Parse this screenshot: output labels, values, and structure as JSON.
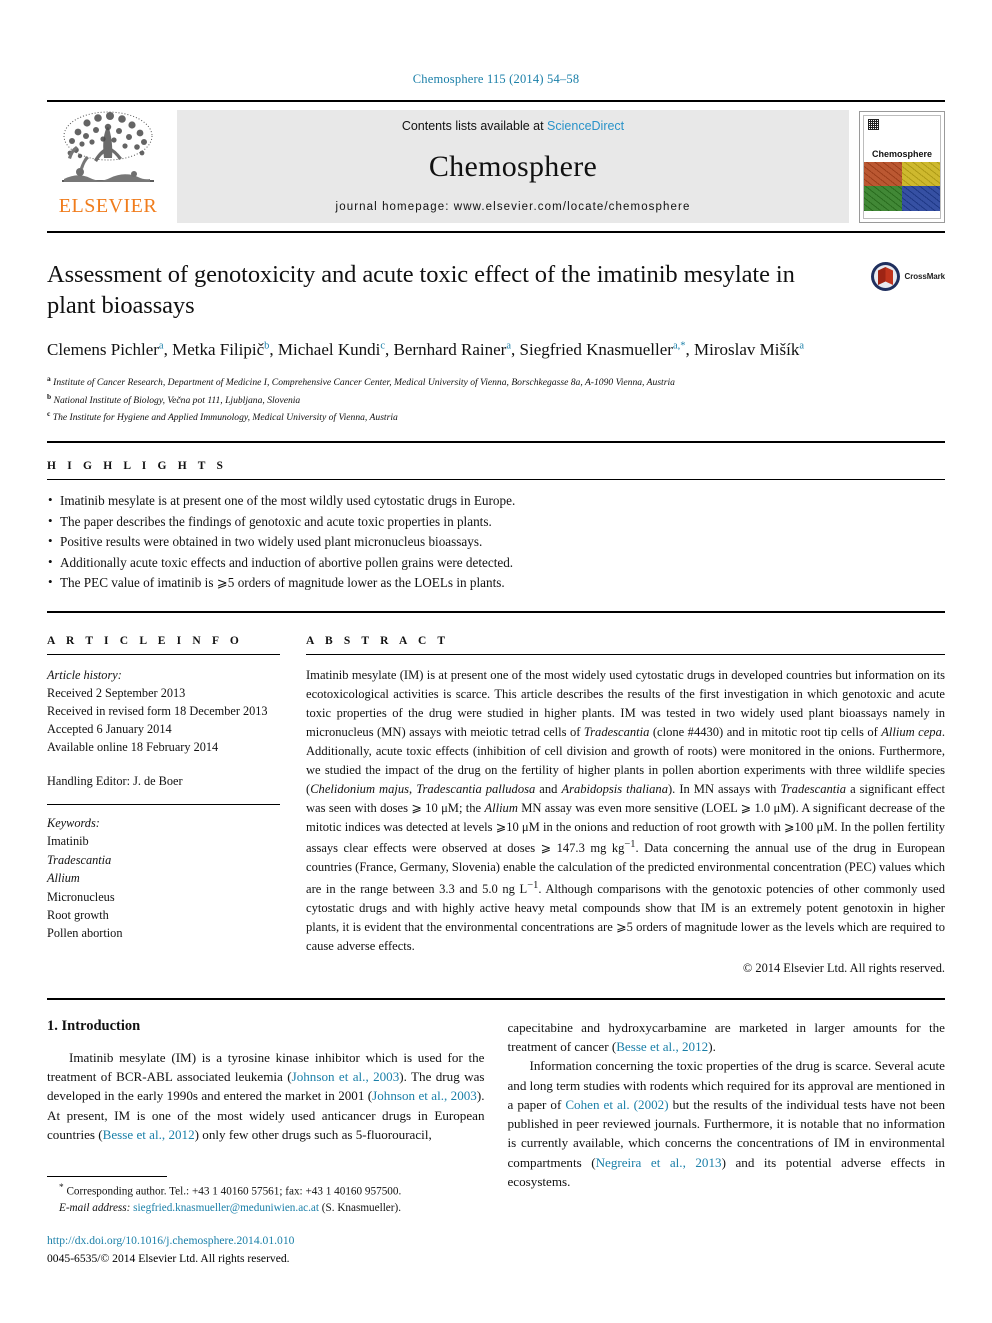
{
  "journal_ref": "Chemosphere 115 (2014) 54–58",
  "masthead": {
    "publisher": "ELSEVIER",
    "contents_prefix": "Contents lists available at ",
    "sciencedirect": "ScienceDirect",
    "journal_title": "Chemosphere",
    "homepage": "journal homepage: www.elsevier.com/locate/chemosphere",
    "cover_title": "Chemosphere",
    "cover_colors": [
      "#b5481f",
      "#c9b21a",
      "#2f7d23",
      "#23409a"
    ]
  },
  "article": {
    "title": "Assessment of genotoxicity and acute toxic effect of the imatinib mesylate in plant bioassays",
    "crossmark_label": "CrossMark",
    "authors": [
      {
        "name": "Clemens Pichler",
        "sup": "a"
      },
      {
        "name": "Metka Filipič",
        "sup": "b"
      },
      {
        "name": "Michael Kundi",
        "sup": "c"
      },
      {
        "name": "Bernhard Rainer",
        "sup": "a"
      },
      {
        "name": "Siegfried Knasmueller",
        "sup": "a,*"
      },
      {
        "name": "Miroslav Mišík",
        "sup": "a"
      }
    ],
    "affiliations": [
      {
        "label": "a",
        "text": "Institute of Cancer Research, Department of Medicine I, Comprehensive Cancer Center, Medical University of Vienna, Borschkegasse 8a, A-1090 Vienna, Austria"
      },
      {
        "label": "b",
        "text": "National Institute of Biology, Večna pot 111, Ljubljana, Slovenia"
      },
      {
        "label": "c",
        "text": "The Institute for Hygiene and Applied Immunology, Medical University of Vienna, Austria"
      }
    ]
  },
  "highlights": {
    "heading": "H I G H L I G H T S",
    "items": [
      "Imatinib mesylate is at present one of the most wildly used cytostatic drugs in Europe.",
      "The paper describes the findings of genotoxic and acute toxic properties in plants.",
      "Positive results were obtained in two widely used plant micronucleus bioassays.",
      "Additionally acute toxic effects and induction of abortive pollen grains were detected.",
      "The PEC value of imatinib is ⩾5 orders of magnitude lower as the LOELs in plants."
    ]
  },
  "article_info": {
    "heading": "A R T I C L E   I N F O",
    "history_label": "Article history:",
    "history": [
      "Received 2 September 2013",
      "Received in revised form 18 December 2013",
      "Accepted 6 January 2014",
      "Available online 18 February 2014"
    ],
    "handling_editor": "Handling Editor: J. de Boer",
    "keywords_label": "Keywords:",
    "keywords": [
      {
        "text": "Imatinib",
        "italic": false
      },
      {
        "text": "Tradescantia",
        "italic": true
      },
      {
        "text": "Allium",
        "italic": true
      },
      {
        "text": "Micronucleus",
        "italic": false
      },
      {
        "text": "Root growth",
        "italic": false
      },
      {
        "text": "Pollen abortion",
        "italic": false
      }
    ]
  },
  "abstract": {
    "heading": "A B S T R A C T",
    "html": "Imatinib mesylate (IM) is at present one of the most widely used cytostatic drugs in developed countries but information on its ecotoxicological activities is scarce. This article describes the results of the first investigation in which genotoxic and acute toxic properties of the drug were studied in higher plants. IM was tested in two widely used plant bioassays namely in micronucleus (MN) assays with meiotic tetrad cells of <i>Tradescantia</i> (clone #4430) and in mitotic root tip cells of <i>Allium cepa</i>. Additionally, acute toxic effects (inhibition of cell division and growth of roots) were monitored in the onions. Furthermore, we studied the impact of the drug on the fertility of higher plants in pollen abortion experiments with three wildlife species (<i>Chelidonium majus</i>, <i>Tradescantia palludosa</i> and <i>Arabidopsis thaliana</i>). In MN assays with <i>Tradescantia</i> a significant effect was seen with doses ⩾ 10 μM; the <i>Allium</i> MN assay was even more sensitive (LOEL ⩾ 1.0 μM). A significant decrease of the mitotic indices was detected at levels ⩾10 μM in the onions and reduction of root growth with ⩾100 μM. In the pollen fertility assays clear effects were observed at doses ⩾ 147.3 mg kg<sup>−1</sup>. Data concerning the annual use of the drug in European countries (France, Germany, Slovenia) enable the calculation of the predicted environmental concentration (PEC) values which are in the range between 3.3 and 5.0 ng L<sup>−1</sup>. Although comparisons with the genotoxic potencies of other commonly used cytostatic drugs and with highly active heavy metal compounds show that IM is an extremely potent genotoxin in higher plants, it is evident that the environmental concentrations are ⩾5 orders of magnitude lower as the levels which are required to cause adverse effects.",
    "copyright": "© 2014 Elsevier Ltd. All rights reserved."
  },
  "introduction": {
    "title": "1. Introduction",
    "left_html": "Imatinib mesylate (IM) is a tyrosine kinase inhibitor which is used for the treatment of BCR-ABL associated leukemia (<span class=\"cit\">Johnson et al., 2003</span>). The drug was developed in the early 1990s and entered the market in 2001 (<span class=\"cit\">Johnson et al., 2003</span>). At present, IM is one of the most widely used anticancer drugs in European countries (<span class=\"cit\">Besse et al., 2012</span>) only few other drugs such as 5-fluorouracil,",
    "right_html_1": "capecitabine and hydroxycarbamine are marketed in larger amounts for the treatment of cancer (<span class=\"cit\">Besse et al., 2012</span>).",
    "right_html_2": "Information concerning the toxic properties of the drug is scarce. Several acute and long term studies with rodents which required for its approval are mentioned in a paper of <span class=\"cit\">Cohen et al. (2002)</span> but the results of the individual tests have not been published in peer reviewed journals. Furthermore, it is notable that no information is currently available, which concerns the concentrations of IM in environmental compartments (<span class=\"cit\">Negreira et al., 2013</span>) and its potential adverse effects in ecosystems."
  },
  "footnote": {
    "corresponding_html": "<sup>*</sup> Corresponding author. Tel.: +43 1 40160 57561; fax: +43 1 40160 957500.",
    "email_html": "<span class=\"ital\">E-mail address:</span> <span class=\"lnk\">siegfried.knasmueller@meduniwien.ac.at</span> (S. Knasmueller).",
    "doi": "http://dx.doi.org/10.1016/j.chemosphere.2014.01.010",
    "issn_line": "0045-6535/© 2014 Elsevier Ltd. All rights reserved."
  },
  "colors": {
    "link": "#1a7fa8",
    "sciencedirect": "#2a93c9",
    "elsevier_orange": "#f07c1c"
  }
}
